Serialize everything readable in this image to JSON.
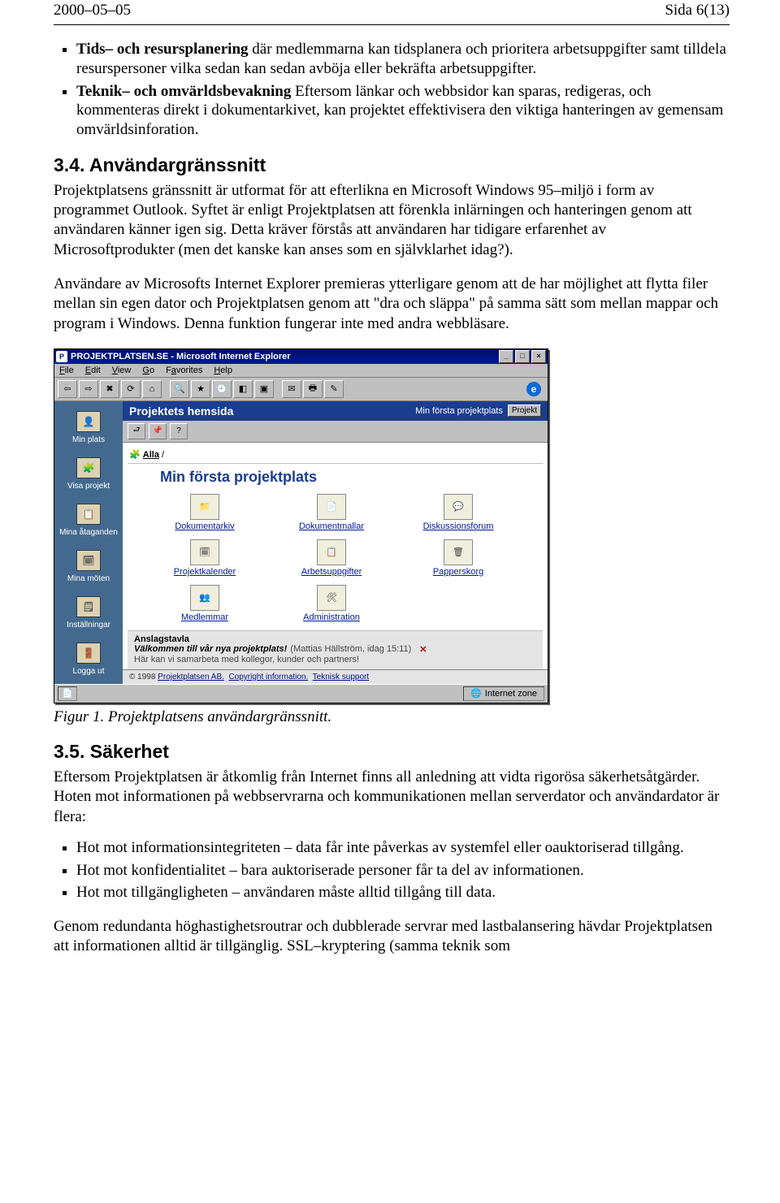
{
  "header": {
    "date": "2000–05–05",
    "page": "Sida 6(13)"
  },
  "bullets_a": [
    {
      "lead": "Tids– och resursplanering",
      "rest": " där medlemmarna kan tidsplanera och prioritera arbetsuppgifter samt tilldela resurspersoner vilka sedan kan sedan avböja eller bekräfta arbetsuppgifter."
    },
    {
      "lead": "Teknik– och omvärldsbevakning",
      "rest": " Eftersom länkar och webbsidor kan sparas, redigeras, och kommenteras direkt i dokumentarkivet, kan projektet effektivisera den viktiga hanteringen av gemensam omvärldsinforation."
    }
  ],
  "sec34": {
    "title": "3.4. Användargränssnitt",
    "p1": "Projektplatsens gränssnitt är utformat för att efterlikna en Microsoft Windows 95–miljö i form av programmet Outlook. Syftet är enligt Projektplatsen att förenkla inlärningen och hanteringen genom att användaren känner igen sig. Detta kräver förstås att användaren har tidigare erfarenhet av Microsoftprodukter (men det kanske kan anses som en självklarhet idag?).",
    "p2": "Användare av Microsofts Internet Explorer premieras ytterligare genom att de har möjlighet att flytta filer mellan sin egen dator och Projektplatsen genom att \"dra och släppa\" på samma sätt som mellan mappar och program i Windows. Denna funktion fungerar inte med andra webbläsare."
  },
  "fig_caption": "Figur 1. Projektplatsens användargränssnitt.",
  "sec35": {
    "title": "3.5. Säkerhet",
    "p1": "Eftersom Projektplatsen är åtkomlig från Internet finns all anledning att vidta rigorösa säkerhetsåtgärder. Hoten mot informationen på webbservrarna och kommunikationen mellan serverdator och användardator är flera:",
    "bullets": [
      "Hot mot informationsintegriteten – data får inte påverkas av systemfel eller oauktoriserad tillgång.",
      "Hot mot konfidentialitet – bara auktoriserade personer får ta del av informationen.",
      "Hot mot tillgängligheten – användaren måste alltid tillgång till data."
    ],
    "p2": "Genom redundanta höghastighetsroutrar och dubblerade servrar med lastbalansering hävdar Projektplatsen att informationen alltid är tillgänglig. SSL–kryptering (samma teknik som"
  },
  "shot": {
    "title": "PROJEKTPLATSEN.SE - Microsoft Internet Explorer",
    "menus": [
      "File",
      "Edit",
      "View",
      "Go",
      "Favorites",
      "Help"
    ],
    "bluebar_title": "Projektets hemsida",
    "bluebar_sub": "Min första projektplats",
    "bluebar_btn": "Projekt",
    "sidebar": [
      "Min plats",
      "Visa projekt",
      "Mina åtaganden",
      "Mina möten",
      "Inställningar",
      "Logga ut"
    ],
    "crumb_label": "Alla",
    "page_title": "Min första projektplats",
    "grid": [
      "Dokumentarkiv",
      "Dokumentmallar",
      "Diskussionsforum",
      "Projektkalender",
      "Arbetsuppgifter",
      "Papperskorg",
      "Medlemmar",
      "Administration"
    ],
    "anslag": {
      "title": "Anslagstavla",
      "line1a": "Välkommen till vår nya projektplats!",
      "line1b": "(Mattias Hällström, idag 15:11)",
      "line2": "Här kan vi samarbeta med kollegor, kunder och partners!"
    },
    "footer": {
      "copyright": "© 1998 ",
      "link1": "Projektplatsen AB.",
      "link2": "Copyright information.",
      "link3": "Teknisk support"
    },
    "status_zone": "Internet zone"
  }
}
